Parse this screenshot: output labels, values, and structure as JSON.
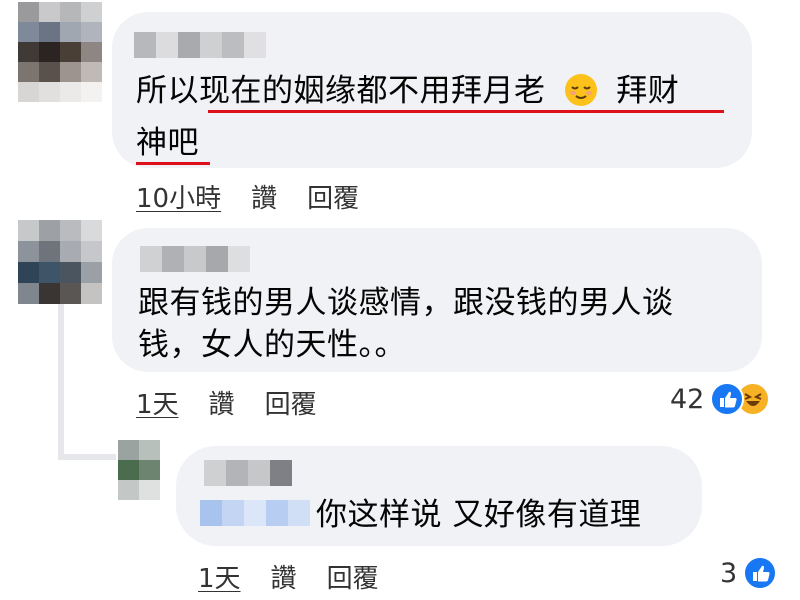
{
  "comments": [
    {
      "text_line1": "所以现在的姻缘都不用拜月老",
      "emoji": "relieved-face",
      "text_line1_tail": "拜财",
      "text_line2": "神吧",
      "time": "10小時",
      "like_label": "讚",
      "reply_label": "回覆"
    },
    {
      "text_line1": "跟有钱的男人谈感情，跟没钱的男人谈",
      "text_line2": "钱，女人的天性。。",
      "time": "1天",
      "like_label": "讚",
      "reply_label": "回覆",
      "reaction_count": "42",
      "reactions": [
        "like",
        "haha"
      ]
    },
    {
      "text": "你这样说 又好像有道理",
      "time": "1天",
      "like_label": "讚",
      "reply_label": "回覆",
      "reaction_count": "3",
      "reactions": [
        "like"
      ]
    }
  ],
  "colors": {
    "bubble": "#f0f2f5",
    "underline": "#e0101a",
    "like": "#1877f2",
    "haha": "#f7b125",
    "thread_line": "#e6e7ea"
  }
}
